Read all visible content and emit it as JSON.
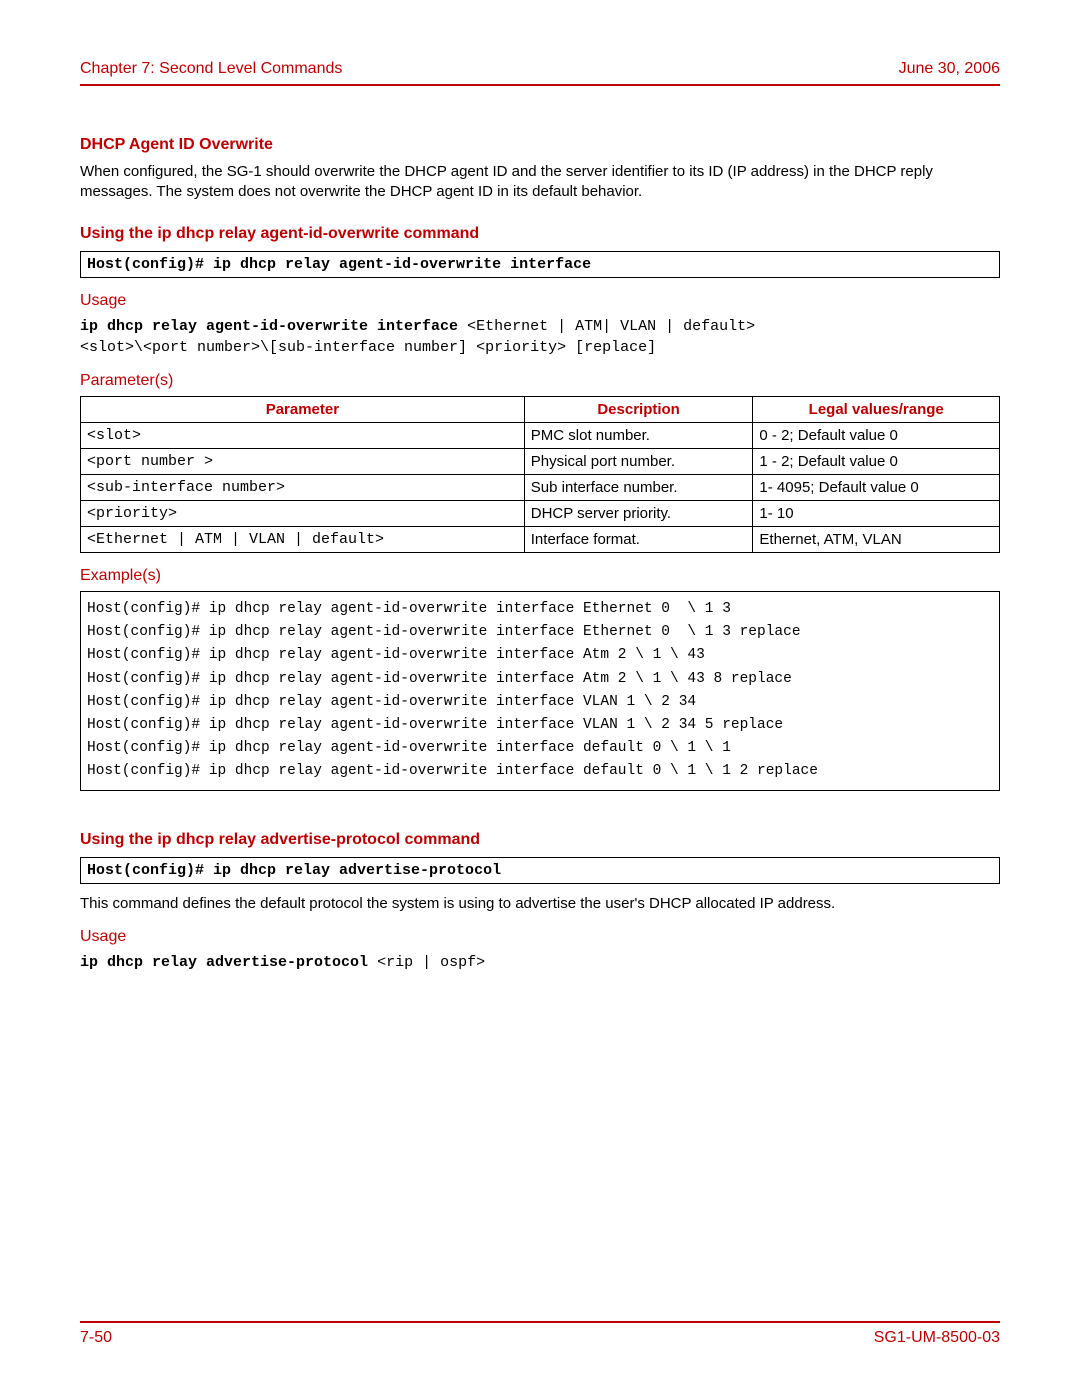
{
  "header": {
    "left": "Chapter 7: Second Level Commands",
    "right": "June 30, 2006"
  },
  "section1": {
    "title": "DHCP Agent ID Overwrite",
    "body": "When configured, the SG-1 should overwrite the DHCP agent ID and the server identifier to its ID (IP address) in the DHCP reply messages. The system does not overwrite the DHCP agent ID in its default behavior."
  },
  "cmd1": {
    "title": "Using the ip dhcp relay agent-id-overwrite command",
    "box": "Host(config)# ip dhcp relay agent-id-overwrite interface",
    "usage_label": "Usage",
    "usage_bold": "ip dhcp relay agent-id-overwrite interface ",
    "usage_rest1": "<Ethernet | ATM| VLAN | default>",
    "usage_rest2": "<slot>\\<port number>\\[sub-interface number] <priority> [replace]",
    "params_label": "Parameter(s)",
    "params_headers": {
      "p": "Parameter",
      "d": "Description",
      "l": "Legal values/range"
    },
    "params": [
      {
        "p": "<slot>",
        "d": "PMC slot number.",
        "l": "0 - 2; Default value 0"
      },
      {
        "p": "<port number >",
        "d": "Physical port number.",
        "l": "1 - 2; Default value 0"
      },
      {
        "p": "<sub-interface number>",
        "d": "Sub interface number.",
        "l": "1- 4095; Default value 0"
      },
      {
        "p": "<priority>",
        "d": "DHCP server priority.",
        "l": "1- 10"
      },
      {
        "p": "<Ethernet | ATM | VLAN | default>",
        "d": "Interface format.",
        "l": "Ethernet, ATM, VLAN"
      }
    ],
    "examples_label": "Example(s)",
    "examples": "Host(config)# ip dhcp relay agent-id-overwrite interface Ethernet 0  \\ 1 3\nHost(config)# ip dhcp relay agent-id-overwrite interface Ethernet 0  \\ 1 3 replace\nHost(config)# ip dhcp relay agent-id-overwrite interface Atm 2 \\ 1 \\ 43\nHost(config)# ip dhcp relay agent-id-overwrite interface Atm 2 \\ 1 \\ 43 8 replace\nHost(config)# ip dhcp relay agent-id-overwrite interface VLAN 1 \\ 2 34\nHost(config)# ip dhcp relay agent-id-overwrite interface VLAN 1 \\ 2 34 5 replace\nHost(config)# ip dhcp relay agent-id-overwrite interface default 0 \\ 1 \\ 1\nHost(config)# ip dhcp relay agent-id-overwrite interface default 0 \\ 1 \\ 1 2 replace"
  },
  "cmd2": {
    "title": "Using the ip dhcp relay advertise-protocol command",
    "box": "Host(config)# ip dhcp relay advertise-protocol",
    "body": "This command defines the default protocol the system is using to advertise the user's DHCP allocated IP address.",
    "usage_label": "Usage",
    "usage_bold": "ip dhcp relay advertise-protocol ",
    "usage_rest": "<rip | ospf>"
  },
  "footer": {
    "left": "7-50",
    "right": "SG1-UM-8500-03"
  }
}
